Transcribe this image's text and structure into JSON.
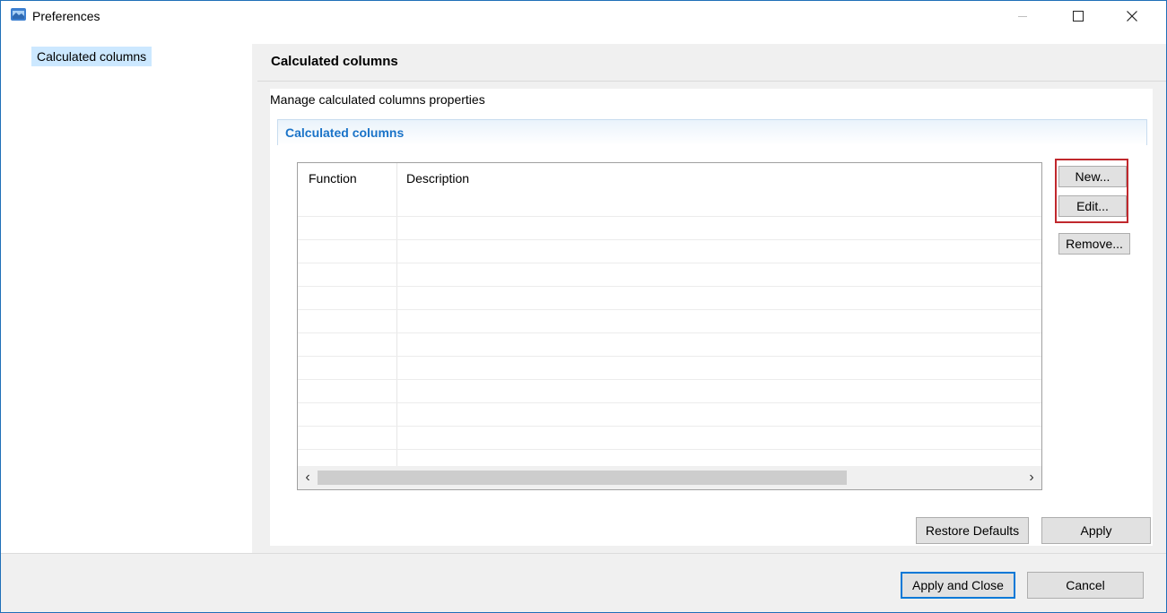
{
  "window": {
    "title": "Preferences"
  },
  "tree": {
    "items": [
      {
        "label": "Calculated columns",
        "selected": true
      }
    ]
  },
  "page": {
    "title": "Calculated columns",
    "description": "Manage calculated columns properties",
    "section_title": "Calculated columns"
  },
  "table": {
    "columns": [
      "Function",
      "Description"
    ],
    "rows": []
  },
  "side_buttons": {
    "new_label": "New...",
    "edit_label": "Edit...",
    "remove_label": "Remove..."
  },
  "page_buttons": {
    "restore_defaults_label": "Restore Defaults",
    "apply_label": "Apply"
  },
  "footer": {
    "apply_close_label": "Apply and Close",
    "cancel_label": "Cancel"
  },
  "colors": {
    "accent": "#0078d7",
    "selection": "#cce8ff",
    "section_title": "#1a73c8",
    "highlight": "#c0282d"
  }
}
